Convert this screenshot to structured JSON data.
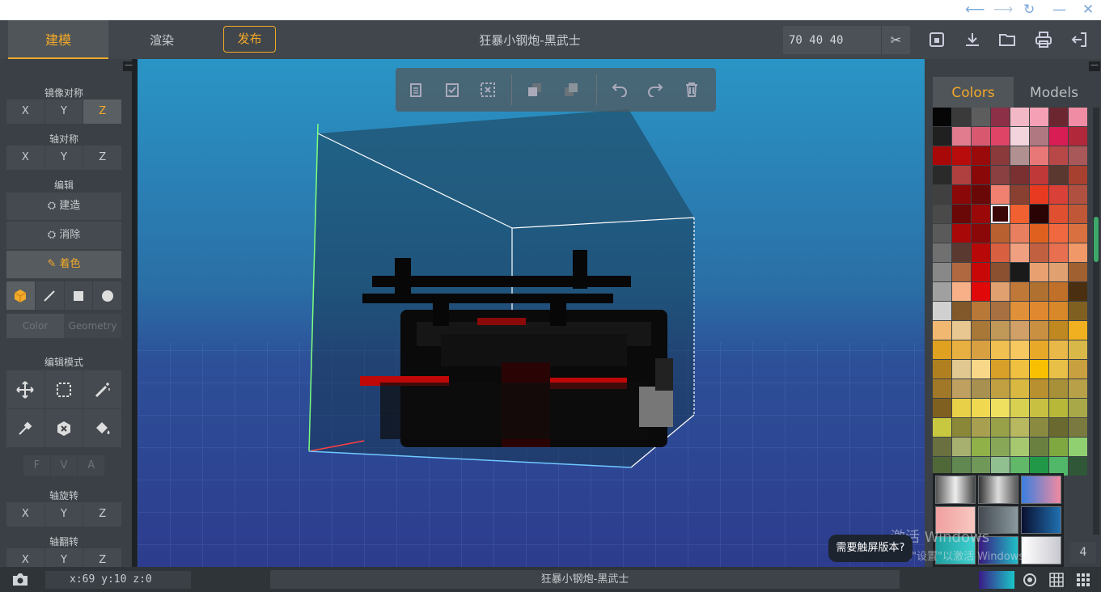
{
  "toolbar": {
    "tab_build": "建模",
    "tab_render": "渲染",
    "publish": "发布",
    "title": "狂暴小钢炮-黑武士",
    "dimensions": "70 40 40"
  },
  "left": {
    "mirror_title": "镜像对称",
    "mirror_axes": [
      "X",
      "Y",
      "Z"
    ],
    "axis_sym_title": "轴对称",
    "axis_sym_axes": [
      "X",
      "Y",
      "Z"
    ],
    "edit_title": "编辑",
    "build": "建造",
    "erase": "消除",
    "paint": "着色",
    "color_tab": "Color",
    "geometry_tab": "Geometry",
    "edit_mode_title": "编辑模式",
    "fva": [
      "F",
      "V",
      "A"
    ],
    "rotate_title": "轴旋转",
    "rotate_axes": [
      "X",
      "Y",
      "Z"
    ],
    "flip_title": "轴翻转",
    "flip_axes": [
      "X",
      "Y",
      "Z"
    ]
  },
  "right": {
    "tab_colors": "Colors",
    "tab_models": "Models",
    "pen_size": "4",
    "palette": [
      "#060606",
      "#3a3a3a",
      "#5d5d5d",
      "#8b3046",
      "#f2b8c6",
      "#f5a0b5",
      "#6b2630",
      "#f08ca3",
      "#202020",
      "#e07c8e",
      "#d85870",
      "#df4466",
      "#f4d4dc",
      "#b07880",
      "#d81c54",
      "#b0283a",
      "#a80808",
      "#b80c0c",
      "#9a0a0a",
      "#8a3a3a",
      "#b09090",
      "#e87878",
      "#b84848",
      "#a85858",
      "#2a2a2a",
      "#b04040",
      "#8a0808",
      "#8a4040",
      "#7a3030",
      "#c03838",
      "#5a3830",
      "#a84030",
      "#404040",
      "#8a0808",
      "#6a0808",
      "#f08070",
      "#8a4030",
      "#e83a20",
      "#d84038",
      "#b05040",
      "#4a4a4a",
      "#6a0808",
      "#9a0808",
      "#3a0606",
      "#f06030",
      "#2a0404",
      "#e05030",
      "#c05838",
      "#5a5a5a",
      "#a80808",
      "#8a0808",
      "#b86030",
      "#e88060",
      "#e06020",
      "#f06840",
      "#d87040",
      "#707070",
      "#5a3a30",
      "#b80808",
      "#d86040",
      "#f0a080",
      "#c06040",
      "#e87050",
      "#f09868",
      "#888888",
      "#b06840",
      "#c80808",
      "#8a5030",
      "#1a1a1a",
      "#e8a070",
      "#e0a070",
      "#a06030",
      "#a0a0a0",
      "#f8b088",
      "#e00808",
      "#e0a070",
      "#c07838",
      "#b07030",
      "#c07028",
      "#4a3010",
      "#d0d0d0",
      "#80582a",
      "#b87838",
      "#a87040",
      "#e09038",
      "#e08830",
      "#d88828",
      "#806020",
      "#f0b870",
      "#e8c890",
      "#a87838",
      "#c09858",
      "#d0a068",
      "#c89040",
      "#c08820",
      "#f0b020",
      "#e0a020",
      "#e8b040",
      "#d8a040",
      "#f0c050",
      "#f8c860",
      "#e8a828",
      "#e8b848",
      "#d8b848",
      "#b08020",
      "#e0c890",
      "#f8d888",
      "#d8a028",
      "#f0c040",
      "#f8c000",
      "#e8c048",
      "#c8a040",
      "#a07828",
      "#c0a060",
      "#a89050",
      "#c0a040",
      "#d8b840",
      "#b89030",
      "#a89038",
      "#b8a048",
      "#806020",
      "#e8d048",
      "#f0d850",
      "#f0e060",
      "#d8d050",
      "#c8c040",
      "#b8b838",
      "#a8a848",
      "#c8c840",
      "#8a8838",
      "#a8a050",
      "#98a048",
      "#b8b860",
      "#8a8a40",
      "#6a6a30",
      "#7a7a40",
      "#6a7040",
      "#a8b070",
      "#90b048",
      "#88a858",
      "#a8c870",
      "#6a8040",
      "#80a840",
      "#90d070",
      "#506838",
      "#608850",
      "#709858",
      "#90c090",
      "#60b868",
      "#209848",
      "#50b868",
      "#305838"
    ],
    "gradients": [
      "g1",
      "g2",
      "g3",
      "g4",
      "g5",
      "g6",
      "g7",
      "g8",
      "g9"
    ]
  },
  "viewport": {
    "float_tools": [
      "copy",
      "paste",
      "clear-selection",
      "layer-front",
      "layer-back",
      "undo",
      "redo",
      "delete"
    ]
  },
  "overlay": {
    "touch_tip": "需要触屏版本?",
    "win1": "激活 Windows",
    "win2": "转到\"设置\"以激活 Windows。"
  },
  "status": {
    "coords": "x:69 y:10 z:0",
    "title": "狂暴小钢炮-黑武士"
  }
}
